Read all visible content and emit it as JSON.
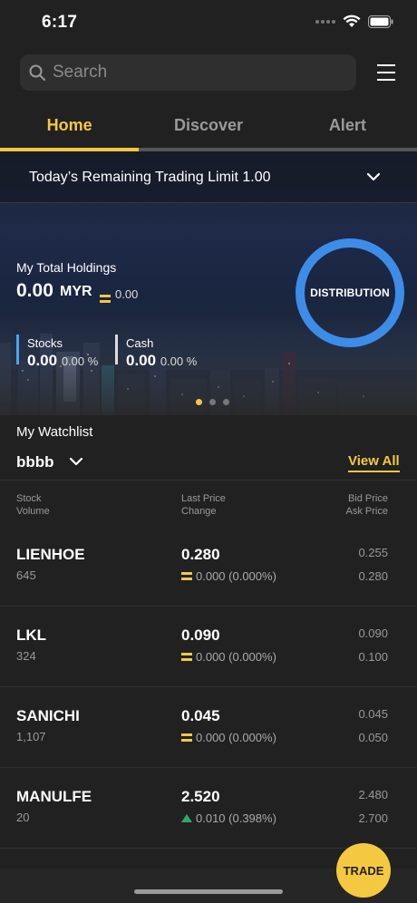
{
  "status": {
    "time": "6:17"
  },
  "search": {
    "placeholder": "Search"
  },
  "tabs": [
    {
      "label": "Home",
      "active": true
    },
    {
      "label": "Discover",
      "active": false
    },
    {
      "label": "Alert",
      "active": false
    }
  ],
  "banner": {
    "trading_limit": "Today’s Remaining Trading Limit 1.00",
    "holdings_label": "My Total Holdings",
    "holdings_value": "0.00",
    "holdings_currency": "MYR",
    "holdings_change": "0.00",
    "distribution_label": "DISTRIBUTION",
    "stocks": {
      "label": "Stocks",
      "value": "0.00",
      "percent": "0.00 %"
    },
    "cash": {
      "label": "Cash",
      "value": "0.00",
      "percent": "0.00 %"
    },
    "page_dots": 3,
    "active_dot": 0
  },
  "watchlist": {
    "title": "My Watchlist",
    "name": "bbbb",
    "view_all": "View All",
    "headers": {
      "col1_line1": "Stock",
      "col1_line2": "Volume",
      "col2_line1": "Last Price",
      "col2_line2": "Change",
      "col3_line1": "Bid Price",
      "col3_line2": "Ask Price"
    },
    "rows": [
      {
        "symbol": "LIENHOE",
        "volume": "645",
        "price": "0.280",
        "change": "0.000 (0.000%)",
        "trend": "flat",
        "bid": "0.255",
        "ask": "0.280"
      },
      {
        "symbol": "LKL",
        "volume": "324",
        "price": "0.090",
        "change": "0.000 (0.000%)",
        "trend": "flat",
        "bid": "0.090",
        "ask": "0.100"
      },
      {
        "symbol": "SANICHI",
        "volume": "1,107",
        "price": "0.045",
        "change": "0.000 (0.000%)",
        "trend": "flat",
        "bid": "0.045",
        "ask": "0.050"
      },
      {
        "symbol": "MANULFE",
        "volume": "20",
        "price": "2.520",
        "change": "0.010 (0.398%)",
        "trend": "up",
        "bid": "2.480",
        "ask": "2.700"
      }
    ]
  },
  "trade_button": "TRADE",
  "colors": {
    "accent": "#f5c842",
    "ring": "#3d8de8",
    "up": "#2ea868"
  }
}
